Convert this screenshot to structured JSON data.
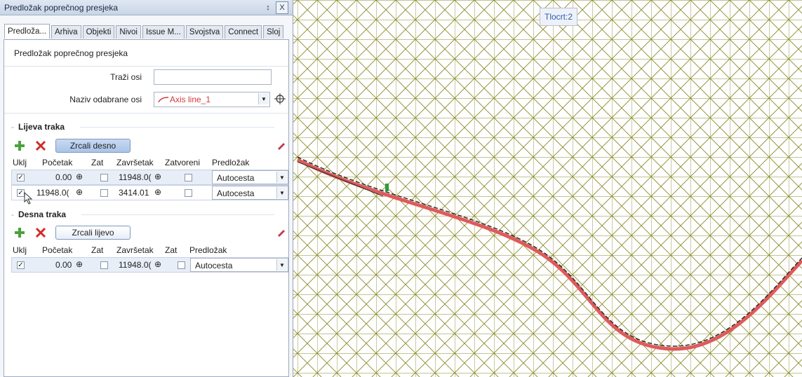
{
  "panel": {
    "title": "Predložak poprečnog presjeka",
    "pin_icon": "↕",
    "close_icon": "X",
    "tabs": [
      "Predloža...",
      "Arhiva",
      "Objekti",
      "Nivoi",
      "Issue M...",
      "Svojstva",
      "Connect",
      "Sloj"
    ],
    "heading": "Predložak poprečnog presjeka",
    "search_label": "Traži osi",
    "search_value": "",
    "axis_label": "Naziv odabrane osi",
    "axis_value": "Axis line_1",
    "left": {
      "title": "Lijeva traka",
      "mirror_label": "Zrcali desno",
      "headers": [
        "Uklj",
        "Početak",
        "Zat",
        "Završetak",
        "Zatvoreni",
        "Predložak"
      ],
      "rows": [
        {
          "start": "0.00",
          "end": "11948.0(",
          "template": "Autocesta"
        },
        {
          "start": "11948.0(",
          "end": "3414.01",
          "template": "Autocesta"
        }
      ]
    },
    "right": {
      "title": "Desna traka",
      "mirror_label": "Zrcali lijevo",
      "headers": [
        "Uklj",
        "Početak",
        "Zat",
        "Završetak",
        "Zat",
        "Predložak"
      ],
      "rows": [
        {
          "start": "0.00",
          "end": "11948.0(",
          "template": "Autocesta"
        }
      ]
    }
  },
  "viewport": {
    "title": "Tlocrt:2",
    "grid_color": "#8a8a2a",
    "road_color": "#e05a5a"
  }
}
